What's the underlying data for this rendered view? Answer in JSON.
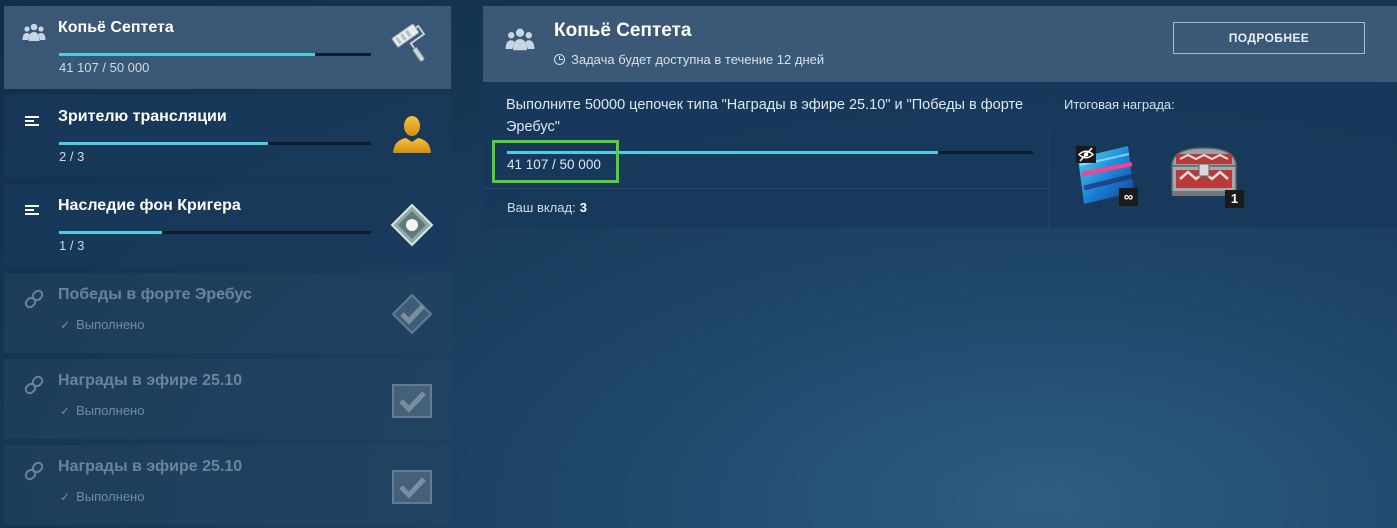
{
  "tasks": [
    {
      "name": "Копьё Септета",
      "progress": "41 107 / 50 000",
      "fraction": 0.82,
      "state": "active",
      "type_icon": "group-icon",
      "reward_icon": "paint-roller-icon"
    },
    {
      "name": "Зрителю трансляции",
      "progress": "2 / 3",
      "fraction": 0.67,
      "state": "in-progress",
      "type_icon": "list-icon",
      "reward_icon": "user-avatar-icon"
    },
    {
      "name": "Наследие фон Кригера",
      "progress": "1 / 3",
      "fraction": 0.33,
      "state": "in-progress",
      "type_icon": "list-icon",
      "reward_icon": "diamond-badge-icon"
    },
    {
      "name": "Победы в форте Эребус",
      "status": "Выполнено",
      "state": "done",
      "type_icon": "link-icon",
      "reward_icon": "check-badge-icon"
    },
    {
      "name": "Награды в эфире 25.10",
      "status": "Выполнено",
      "state": "done",
      "type_icon": "link-icon",
      "reward_icon": "check-box-icon"
    },
    {
      "name": "Награды в эфире 25.10",
      "status": "Выполнено",
      "state": "done",
      "type_icon": "link-icon",
      "reward_icon": "check-box-icon"
    }
  ],
  "detail": {
    "title": "Копьё Септета",
    "availability": "Задача будет доступна в течение 12 дней",
    "more_button": "ПОДРОБНЕЕ",
    "description": "Выполните 50000 цепочек типа \"Награды в эфире 25.10\" и \"Победы в форте Эребус\"",
    "progress": "41 107 / 50 000",
    "fraction": 0.82,
    "contribution_label": "Ваш вклад:",
    "contribution_value": "3",
    "reward_title": "Итоговая награда:",
    "rewards": [
      {
        "icon": "camouflage-icon",
        "qty": "∞",
        "badge_icon": "hidden-eye-icon"
      },
      {
        "icon": "treasure-chest-icon",
        "qty": "1"
      }
    ]
  },
  "colors": {
    "accent": "#4dcde0",
    "highlight": "#55d12a",
    "active_row": "#3a5775"
  }
}
